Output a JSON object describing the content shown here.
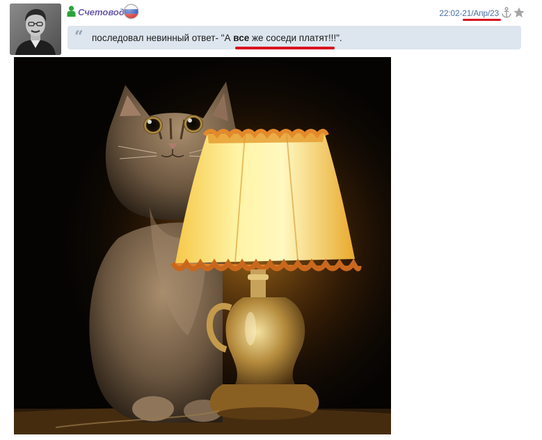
{
  "post": {
    "author": {
      "name": "Счетовод",
      "status_icon": "user-online-icon",
      "flag_icon": "russia-flag-icon"
    },
    "timestamp": "22:02-21/Апр/23",
    "actions": {
      "anchor_icon": "anchor-icon",
      "favorite_icon": "star-icon"
    },
    "quote": {
      "icon": "quote-icon",
      "before": "последовал невинный ответ- \"А ",
      "emphasis": "все",
      "after": " же соседи платят!!!\"."
    },
    "image": {
      "subject": "cat-behind-lamp-photo"
    }
  },
  "colors": {
    "username": "#6b5aa8",
    "timestamp": "#4a6fa5",
    "quote_bg": "#dde5ee",
    "highlight_underline": "#d8121f"
  }
}
